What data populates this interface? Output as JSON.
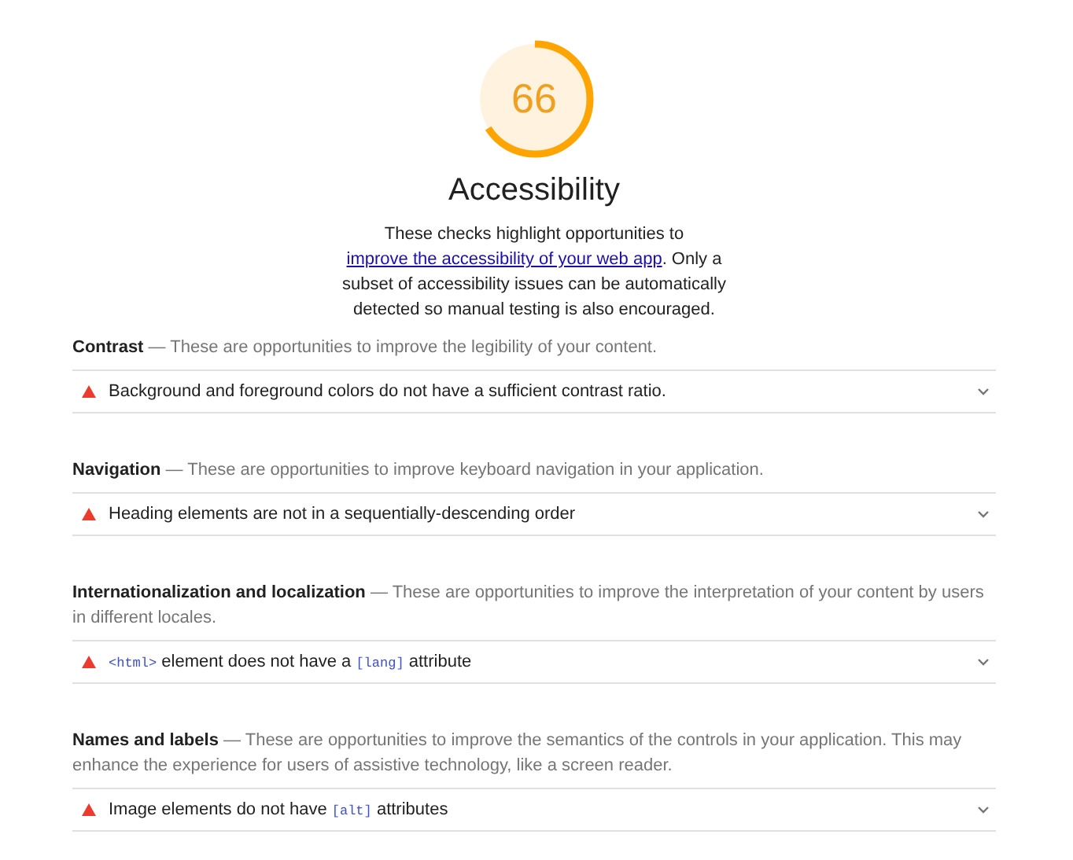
{
  "score": {
    "value": "66"
  },
  "title": "Accessibility",
  "description": [
    {
      "kind": "text",
      "text": "These checks highlight opportunities to "
    },
    {
      "kind": "link",
      "text": "improve the accessibility of your web app"
    },
    {
      "kind": "text",
      "text": ". Only a subset of accessibility issues can be automatically detected so manual testing is also encouraged."
    }
  ],
  "groups": [
    {
      "title": "Contrast",
      "description": "— These are opportunities to improve the legibility of your content.",
      "audits": [
        {
          "title": [
            {
              "kind": "text",
              "text": "Background and foreground colors do not have a sufficient contrast ratio."
            }
          ],
          "expanded": false
        }
      ]
    },
    {
      "title": "Navigation",
      "description": "— These are opportunities to improve keyboard navigation in your application.",
      "audits": [
        {
          "title": [
            {
              "kind": "text",
              "text": "Heading elements are not in a sequentially-descending order"
            }
          ],
          "expanded": false
        }
      ]
    },
    {
      "title": "Internationalization and localization",
      "description": "— These are opportunities to improve the interpretation of your content by users in different locales.",
      "audits": [
        {
          "title": [
            {
              "kind": "code",
              "text": "<html>"
            },
            {
              "kind": "text",
              "text": " element does not have a "
            },
            {
              "kind": "code",
              "text": "[lang]"
            },
            {
              "kind": "text",
              "text": " attribute"
            }
          ],
          "expanded": false
        }
      ]
    },
    {
      "title": "Names and labels",
      "description": "— These are opportunities to improve the semantics of the controls in your application. This may enhance the experience for users of assistive technology, like a screen reader.",
      "audits": [
        {
          "title": [
            {
              "kind": "text",
              "text": "Image elements do not have "
            },
            {
              "kind": "code",
              "text": "[alt]"
            },
            {
              "kind": "text",
              "text": " attributes"
            }
          ],
          "expanded": false
        }
      ]
    }
  ]
}
